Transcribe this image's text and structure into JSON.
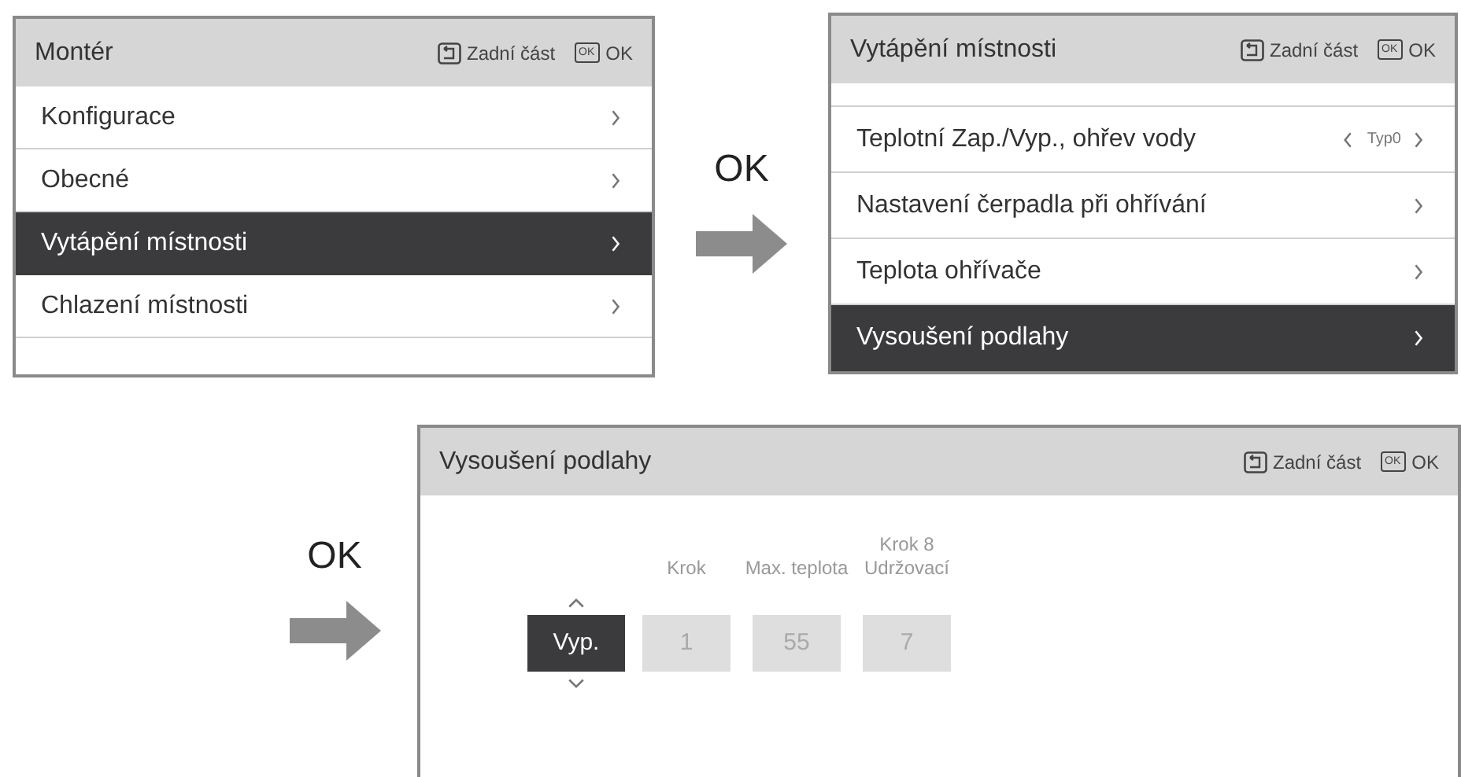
{
  "screens": [
    {
      "kind": "menu",
      "title": "Montér",
      "back_label": "Zadní část",
      "ok_key": "OK",
      "ok_label": "OK",
      "items": [
        {
          "label": "Konfigurace",
          "selected": false
        },
        {
          "label": "Obecné",
          "selected": false
        },
        {
          "label": "Vytápění místnosti",
          "selected": true
        },
        {
          "label": "Chlazení místnosti",
          "selected": false
        }
      ]
    },
    {
      "kind": "menu",
      "title": "Vytápění místnosti",
      "back_label": "Zadní část",
      "ok_key": "OK",
      "ok_label": "OK",
      "items": [
        {
          "label": "Teplotní Zap./Vyp., ohřev vody",
          "value": "Typ0",
          "selected": false
        },
        {
          "label": "Nastavení čerpadla při ohřívání",
          "selected": false
        },
        {
          "label": "Teplota ohřívače",
          "selected": false
        },
        {
          "label": "Vysoušení podlahy",
          "selected": true
        }
      ]
    },
    {
      "kind": "steps",
      "title": "Vysoušení podlahy",
      "back_label": "Zadní část",
      "ok_key": "OK",
      "ok_label": "OK",
      "columns": [
        {
          "value": "Vyp.",
          "selected": true
        },
        {
          "label": "Krok",
          "value": "1",
          "selected": false
        },
        {
          "label": "Max. teplota",
          "value": "55",
          "selected": false
        },
        {
          "label": "Krok 8 Udržovací",
          "value": "7",
          "selected": false
        }
      ]
    }
  ],
  "arrows": [
    {
      "label": "OK"
    },
    {
      "label": "OK"
    }
  ]
}
